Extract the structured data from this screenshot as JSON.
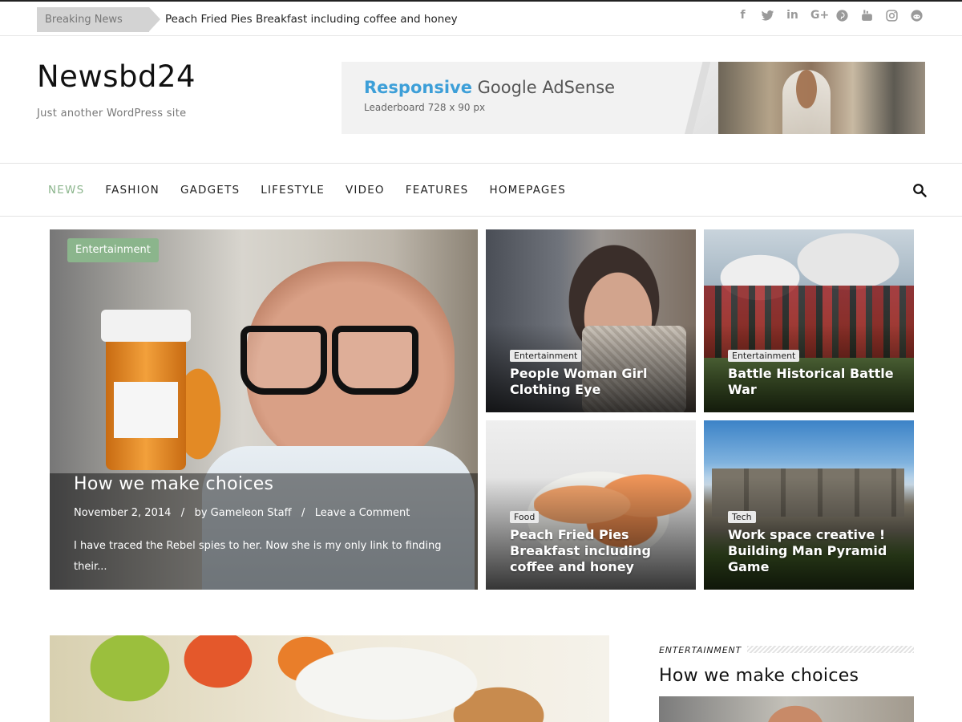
{
  "topbar": {
    "breaking_label": "Breaking News",
    "breaking_text": "Peach Fried Pies Breakfast including coffee and honey",
    "social_icons": [
      "facebook-icon",
      "twitter-icon",
      "linkedin-icon",
      "google-plus-icon",
      "pinterest-icon",
      "youtube-icon",
      "instagram-icon",
      "reddit-icon"
    ]
  },
  "header": {
    "site_title": "Newsbd24",
    "tagline": "Just another WordPress site",
    "ad": {
      "title_highlight": "Responsive",
      "title_rest": " Google AdSense",
      "subtitle": "Leaderboard 728 x 90 px"
    }
  },
  "nav": {
    "items": [
      {
        "label": "NEWS",
        "active": true
      },
      {
        "label": "FASHION",
        "active": false
      },
      {
        "label": "GADGETS",
        "active": false
      },
      {
        "label": "LIFESTYLE",
        "active": false
      },
      {
        "label": "VIDEO",
        "active": false
      },
      {
        "label": "FEATURES",
        "active": false
      },
      {
        "label": "HOMEPAGES",
        "active": false
      }
    ],
    "active_color": "#8bb58c"
  },
  "featured": {
    "category": "Entertainment",
    "title": "How we make choices",
    "date": "November 2, 2014",
    "separator": "/",
    "author": "by Gameleon Staff",
    "comment_link": "Leave a Comment",
    "excerpt": "I have traced the Rebel spies to her. Now she is my only link to finding their..."
  },
  "grid": [
    {
      "category": "Entertainment",
      "title_lines": [
        "People Woman Girl",
        "Clothing Eye"
      ]
    },
    {
      "category": "Entertainment",
      "title_lines": [
        "Battle Historical Battle",
        "War"
      ]
    },
    {
      "category": "Food",
      "title_lines": [
        "Peach Fried Pies",
        "Breakfast including",
        "coffee and honey"
      ]
    },
    {
      "category": "Tech",
      "title_lines": [
        "Work space creative !",
        "Building Man Pyramid",
        "Game"
      ]
    }
  ],
  "sidebar": {
    "category": "ENTERTAINMENT",
    "title": "How we make choices"
  }
}
